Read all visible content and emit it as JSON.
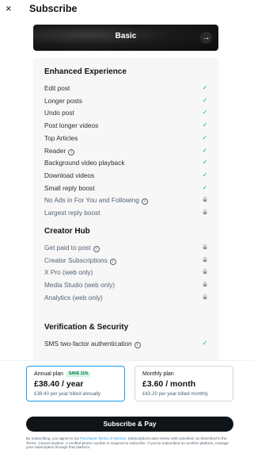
{
  "header": {
    "close_glyph": "×",
    "title": "Subscribe"
  },
  "tier": {
    "name": "Basic",
    "arrow_glyph": "→"
  },
  "sections": [
    {
      "title": "Enhanced Experience",
      "items": [
        {
          "label": "Edit post",
          "info": false,
          "status": "check"
        },
        {
          "label": "Longer posts",
          "info": false,
          "status": "check"
        },
        {
          "label": "Undo post",
          "info": false,
          "status": "check"
        },
        {
          "label": "Post longer videos",
          "info": false,
          "status": "check"
        },
        {
          "label": "Top Articles",
          "info": false,
          "status": "check"
        },
        {
          "label": "Reader",
          "info": true,
          "status": "check"
        },
        {
          "label": "Background video playback",
          "info": false,
          "status": "check"
        },
        {
          "label": "Download videos",
          "info": false,
          "status": "check"
        },
        {
          "label": "Small reply boost",
          "info": false,
          "status": "check"
        },
        {
          "label": "No Ads in For You and Following",
          "info": true,
          "status": "lock"
        },
        {
          "label": "Largest reply boost",
          "info": false,
          "status": "lock"
        }
      ]
    },
    {
      "title": "Creator Hub",
      "items": [
        {
          "label": "Get paid to post",
          "info": true,
          "status": "lock"
        },
        {
          "label": "Creator Subscriptions",
          "info": true,
          "status": "lock"
        },
        {
          "label": "X Pro (web only)",
          "info": false,
          "status": "lock"
        },
        {
          "label": "Media Studio (web only)",
          "info": false,
          "status": "lock"
        },
        {
          "label": "Analytics (web only)",
          "info": false,
          "status": "lock"
        }
      ]
    },
    {
      "title": "Verification & Security",
      "items": [
        {
          "label": "SMS two-factor authentication",
          "info": true,
          "status": "check"
        }
      ]
    }
  ],
  "glyphs": {
    "check": "✓",
    "lock": "🔒",
    "info": "i"
  },
  "icons": {
    "check": "checkmark-icon",
    "lock": "lock-icon",
    "info": "info-icon"
  },
  "plans": {
    "annual": {
      "name": "Annual plan",
      "badge": "SAVE 11%",
      "price": "£38.40 / year",
      "sub": "£38.40 per year billed annually"
    },
    "monthly": {
      "name": "Monthly plan",
      "price": "£3.60 / month",
      "sub": "£43.20 per year billed monthly"
    }
  },
  "cta": {
    "label": "Subscribe & Pay"
  },
  "legal": {
    "pre": "By subscribing, you agree to our ",
    "link": "Purchaser Terms of Service",
    "post": ". Subscriptions auto-renew until canceled, as described in the Terms. Cancel anytime. A verified phone number is required to subscribe. If you've subscribed on another platform, manage your subscription through that platform."
  },
  "colors": {
    "accent": "#1d9bf0",
    "check": "#00ba7c",
    "cta_bg": "#0f1419",
    "badge_bg": "#d1f3e0"
  }
}
